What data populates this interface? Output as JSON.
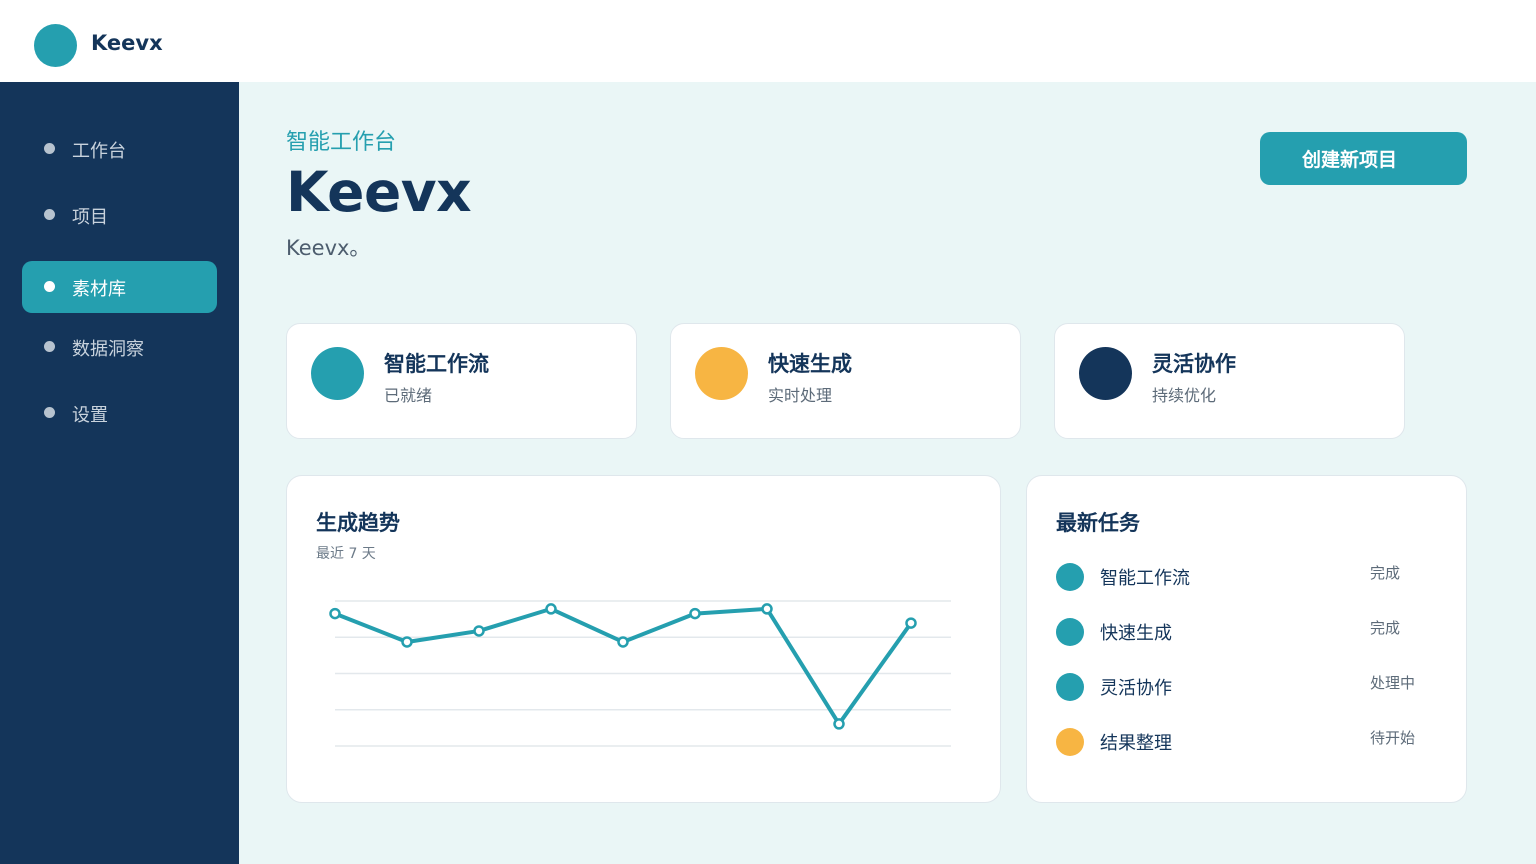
{
  "app": {
    "logo_text": "Keevx"
  },
  "sidebar": {
    "items": [
      {
        "label": "工作台",
        "active": false
      },
      {
        "label": "项目",
        "active": false
      },
      {
        "label": "素材库",
        "active": true
      },
      {
        "label": "数据洞察",
        "active": false
      },
      {
        "label": "设置",
        "active": false
      }
    ]
  },
  "header": {
    "subtitle": "智能工作台",
    "title": "Keevx",
    "description": "Keevx。",
    "create_button": "创建新项目"
  },
  "cards": [
    {
      "title": "智能工作流",
      "subtitle": "已就绪",
      "color": "#259faf"
    },
    {
      "title": "快速生成",
      "subtitle": "实时处理",
      "color": "#f7b543"
    },
    {
      "title": "灵活协作",
      "subtitle": "持续优化",
      "color": "#14355a"
    }
  ],
  "trend_panel": {
    "title": "生成趋势",
    "subtitle": "最近 7 天"
  },
  "chart_data": {
    "type": "line",
    "series": [
      {
        "values": [
          84,
          66,
          73,
          87,
          66,
          84,
          87,
          14,
          78
        ]
      }
    ],
    "ylim": [
      0,
      92
    ],
    "grid": true,
    "color": "#259faf"
  },
  "tasks_panel": {
    "title": "最新任务",
    "items": [
      {
        "name": "智能工作流",
        "status": "完成",
        "color": "#259faf"
      },
      {
        "name": "快速生成",
        "status": "完成",
        "color": "#259faf"
      },
      {
        "name": "灵活协作",
        "status": "处理中",
        "color": "#259faf"
      },
      {
        "name": "结果整理",
        "status": "待开始",
        "color": "#f7b543"
      }
    ]
  }
}
